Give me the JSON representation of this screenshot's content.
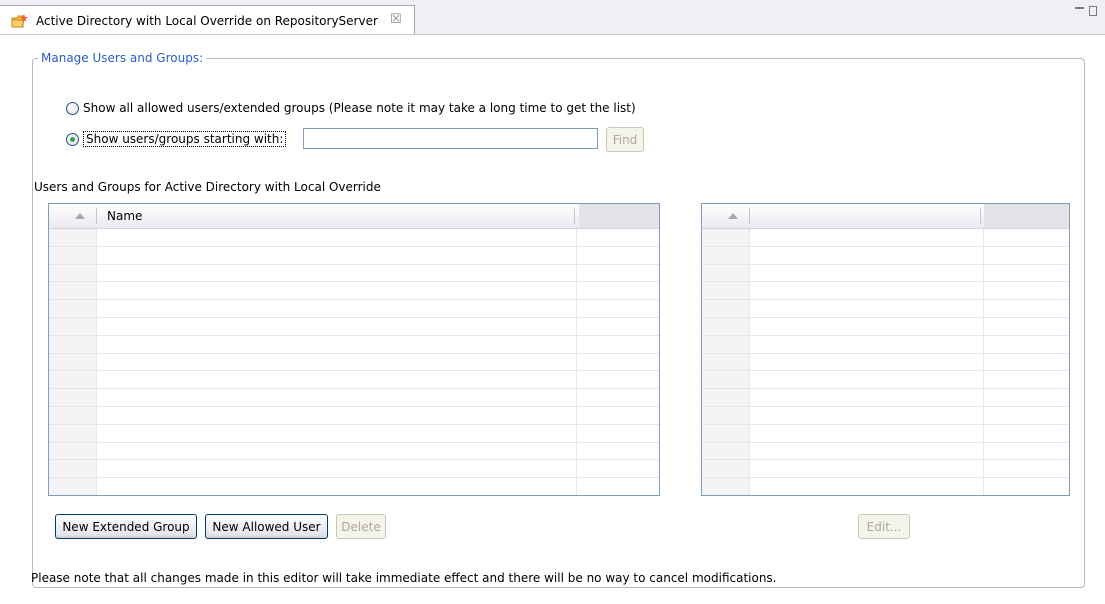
{
  "tab": {
    "title": "Active Directory with Local Override on RepositoryServer",
    "icon": "folder-edit-icon",
    "close_glyph": "☒"
  },
  "group": {
    "legend": "Manage Users and Groups:"
  },
  "options": {
    "show_all_label": "Show all allowed users/extended groups (Please note it may take a long time to get the list)",
    "show_starting_label": "Show users/groups starting with:",
    "selected": "show_starting",
    "filter_value": "",
    "find_label": "Find"
  },
  "users_table": {
    "label": "Users and Groups for Active Directory with Local Override",
    "columns": [
      "Name"
    ],
    "rows": []
  },
  "detail_table": {
    "columns": [
      ""
    ],
    "rows": []
  },
  "buttons": {
    "new_extended_group": "New Extended Group",
    "new_allowed_user": "New Allowed User",
    "delete": "Delete",
    "edit": "Edit..."
  },
  "footer": {
    "note": "Please note that all changes made in this editor will take immediate effect and there will be no way to cancel modifications."
  },
  "colors": {
    "legend": "#2b5ec1",
    "border": "#7f9db9"
  }
}
